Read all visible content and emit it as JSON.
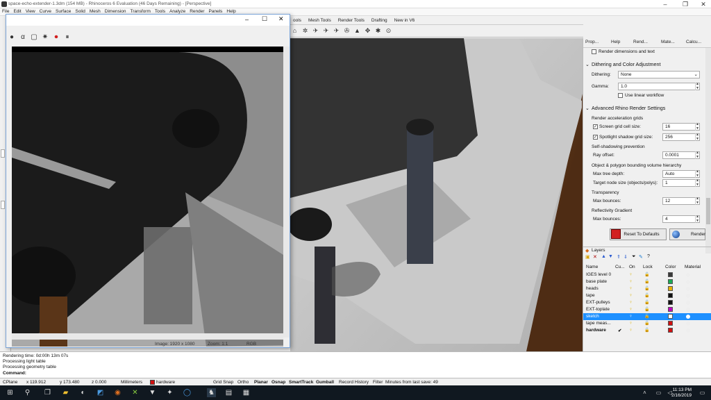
{
  "app": {
    "title": "space-echo-extender-1.3dm (154 MB) - Rhinoceros 6 Evaluation (46 Days Remaining) - [Perspective]"
  },
  "menu": [
    "File",
    "Edit",
    "View",
    "Curve",
    "Surface",
    "Solid",
    "Mesh",
    "Dimension",
    "Transform",
    "Tools",
    "Analyze",
    "Render",
    "Panels",
    "Help"
  ],
  "toolbar_tabs": [
    "ools",
    "Mesh Tools",
    "Render Tools",
    "Drafting",
    "New in V6"
  ],
  "render_window": {
    "status_image": "Image: 1920 x 1080",
    "status_zoom": "Zoom: 1:1",
    "status_mode": "RGB"
  },
  "panel": {
    "tabs": [
      "Prop...",
      "Help",
      "Rend...",
      "Mate...",
      "Calcu..."
    ],
    "render_dims_label": "Render dimensions and text",
    "dithering_header": "Dithering and Color Adjustment",
    "dithering_label": "Dithering:",
    "dithering_value": "None",
    "gamma_label": "Gamma:",
    "gamma_value": "1.0",
    "linear_label": "Use linear workflow",
    "advanced_header": "Advanced Rhino Render Settings",
    "accel_label": "Render acceleration grids",
    "screen_grid_label": "Screen grid cell size:",
    "screen_grid_value": "16",
    "spotlight_label": "Spotlight shadow grid size:",
    "spotlight_value": "256",
    "selfshadow_label": "Self-shadowing prevention",
    "ray_label": "Ray offset:",
    "ray_value": "0.0001",
    "bvh_label": "Object & polygon bounding volume hierarchy",
    "max_tree_label": "Max tree depth:",
    "max_tree_value": "Auto",
    "target_node_label": "Target node size (objects/polys):",
    "target_node_value": "1",
    "transparency_label": "Transparency",
    "max_bounces_label": "Max bounces:",
    "transparency_bounces": "12",
    "reflectivity_label": "Reflectivity Gradient",
    "max_bounces_label2": "Max bounces:",
    "reflectivity_bounces": "4",
    "reset_label": "Reset To Defaults",
    "render_label": "Render"
  },
  "layers": {
    "title": "Layers",
    "columns": [
      "Name",
      "Cu...",
      "On",
      "Lock",
      "Color",
      "Material"
    ],
    "rows": [
      {
        "name": "IGES level 0",
        "color": "#3a3a3a",
        "bold": false,
        "selected": false
      },
      {
        "name": "base plate",
        "color": "#1aaa55",
        "bold": false,
        "selected": false
      },
      {
        "name": "heads",
        "color": "#e8b000",
        "bold": false,
        "selected": false
      },
      {
        "name": "tape",
        "color": "#111111",
        "bold": false,
        "selected": false
      },
      {
        "name": "EXT-pulleys",
        "color": "#111111",
        "bold": false,
        "selected": false
      },
      {
        "name": "EXT-toplate",
        "color": "#c000c0",
        "bold": false,
        "selected": false
      },
      {
        "name": "sketch",
        "color": "#ffffff",
        "bold": false,
        "selected": true
      },
      {
        "name": "tape meas...",
        "color": "#d01010",
        "bold": false,
        "selected": false
      },
      {
        "name": "hardware",
        "color": "#d01010",
        "bold": true,
        "selected": false
      }
    ],
    "current_mark": "✔"
  },
  "command": {
    "lines": [
      "Rendering time: 0d:00h 13m 07s",
      "Processing light table",
      "Processing geometry table"
    ],
    "prompt": "Command:"
  },
  "status": {
    "cplane": "CPlane",
    "x": "x 119.912",
    "y": "y 173.480",
    "z": "z 0.000",
    "units": "Millimeters",
    "layer": "hardware",
    "grid_snap": "Grid Snap",
    "ortho": "Ortho",
    "planar": "Planar",
    "osnap": "Osnap",
    "smarttrack": "SmartTrack",
    "gumball": "Gumball",
    "record": "Record History",
    "filter": "Filter",
    "minutes": "Minutes from last save: 49"
  },
  "taskbar": {
    "time": "11:13 PM",
    "date": "2/16/2019"
  }
}
